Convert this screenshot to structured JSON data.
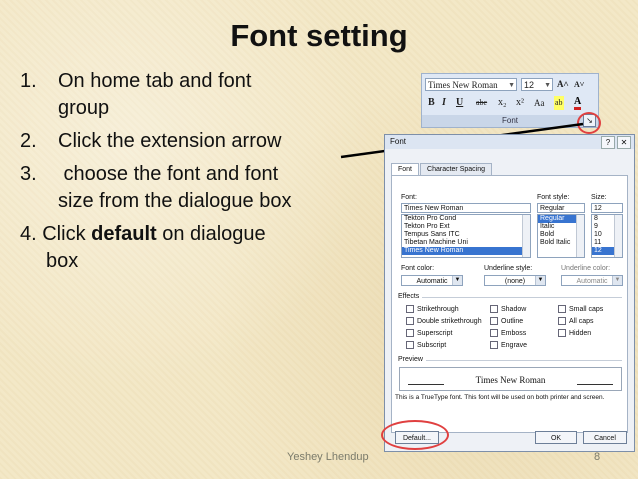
{
  "slide": {
    "title": "Font setting",
    "bullets": [
      {
        "num": "1.",
        "line1": "On home tab and font",
        "line2": "group"
      },
      {
        "num": "2.",
        "line1": "Click the extension arrow"
      },
      {
        "num": "3.",
        "line1": " choose the font and font",
        "line2": "size from the dialogue box"
      }
    ],
    "bullet4": {
      "prefix": "4. Click ",
      "bold": "default",
      "suffix": " on dialogue",
      "line2": "box"
    },
    "footer_author": "Yeshey Lhendup",
    "page_number": "8"
  },
  "ribbon": {
    "font_value": "Times New Roman",
    "size_value": "12",
    "grow": "A˄",
    "shrink": "A˅",
    "bold": "B",
    "italic": "I",
    "underline": "U",
    "strike": "abe",
    "subscript": "x₂",
    "superscript": "x²",
    "case": "Aa",
    "highlight": "ab",
    "color": "A",
    "group_label": "Font",
    "launcher_icon": "↘"
  },
  "dialog": {
    "title": "Font",
    "help": "?",
    "close": "✕",
    "tabs": [
      "Font",
      "Character Spacing"
    ],
    "font_label": "Font:",
    "font_value": "Times New Roman",
    "font_list": [
      "Tekton Pro Cond",
      "Tekton Pro Ext",
      "Tempus Sans ITC",
      "Tibetan Machine Uni",
      "Times New Roman"
    ],
    "style_label": "Font style:",
    "style_value": "Regular",
    "style_list": [
      "Regular",
      "Italic",
      "Bold",
      "Bold Italic"
    ],
    "size_label": "Size:",
    "size_value": "12",
    "size_list": [
      "8",
      "9",
      "10",
      "11",
      "12"
    ],
    "font_color_label": "Font color:",
    "font_color_value": "Automatic",
    "underline_style_label": "Underline style:",
    "underline_style_value": "(none)",
    "underline_color_label": "Underline color:",
    "underline_color_value": "Automatic",
    "effects_label": "Effects",
    "effects": [
      [
        "Strikethrough",
        "Shadow",
        "Small caps"
      ],
      [
        "Double strikethrough",
        "Outline",
        "All caps"
      ],
      [
        "Superscript",
        "Emboss",
        "Hidden"
      ],
      [
        "Subscript",
        "Engrave"
      ]
    ],
    "preview_label": "Preview",
    "preview_text": "Times New Roman",
    "note": "This is a TrueType font. This font will be used on both printer and screen.",
    "default_button": "Default...",
    "ok_button": "OK",
    "cancel_button": "Cancel"
  },
  "colors": {
    "highlight_ring": "#e04040",
    "accent_selection": "#3874d0"
  }
}
